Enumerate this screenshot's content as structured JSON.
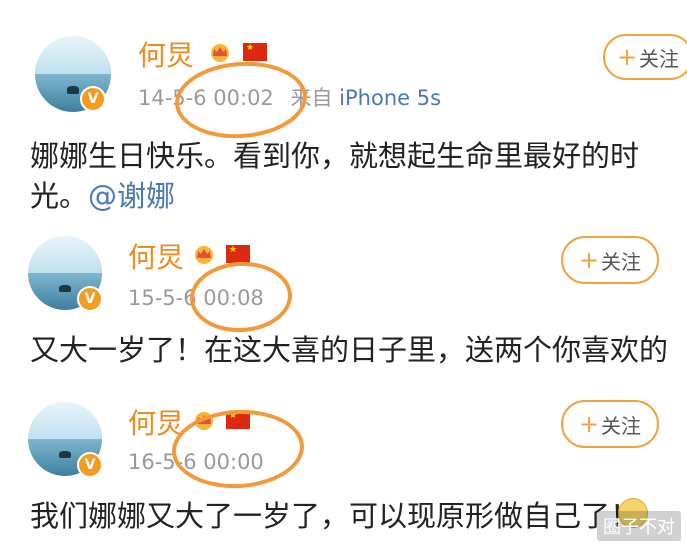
{
  "posts": [
    {
      "author": "何炅",
      "time": "14-5-6 00:02",
      "source": "来自",
      "device": "iPhone 5s",
      "follow_label": "关注",
      "text": "娜娜生日快乐。看到你，就想起生命里最好的时光。",
      "mention": "@谢娜"
    },
    {
      "author": "何炅",
      "time": "15-5-6 00:08",
      "follow_label": "关注",
      "text": "又大一岁了！在这大喜的日子里，送两个你喜欢的"
    },
    {
      "author": "何炅",
      "time": "16-5-6 00:00",
      "follow_label": "关注",
      "text": "我们娜娜又大了一岁了，可以现原形做自己了！"
    }
  ],
  "icons": {
    "verified_badge": "V",
    "crown": "crown-icon",
    "flag": "china-flag-icon",
    "plus": "+"
  },
  "watermark": "圈子不对",
  "colors": {
    "name": "#ef8a1f",
    "meta": "#9a9a9a",
    "link": "#4a7ab5",
    "follow_border": "#f0a23e",
    "annotation": "#f29a3a"
  }
}
